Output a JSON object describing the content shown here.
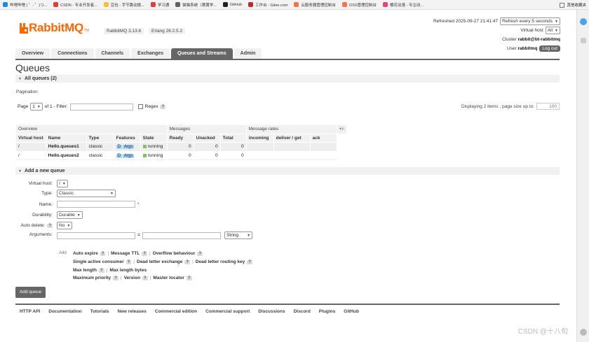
{
  "bookmarks": [
    {
      "label": "哔哩哔哩 ( ゜- ゜)つ...",
      "color": "#1e88e5"
    },
    {
      "label": "CSDN - 专业开发者...",
      "color": "#e53935"
    },
    {
      "label": "豆包 - 字节跳动旗...",
      "color": "#fbc02d"
    },
    {
      "label": "学习通",
      "color": "#e53935"
    },
    {
      "label": "猫猫系统（莆莆学...",
      "color": "#616161"
    },
    {
      "label": "GitHub",
      "color": "#212121"
    },
    {
      "label": "工作台 - Gitee.com",
      "color": "#c62828"
    },
    {
      "label": "云服务器管理控制台",
      "color": "#ff7043"
    },
    {
      "label": "OSS管理控制台",
      "color": "#ff7043"
    },
    {
      "label": "樱花动漫 - 专注动...",
      "color": "#ec407a"
    }
  ],
  "bookmarks_folder": "其他收藏夹",
  "brand": "RabbitMQ",
  "brand_tm": "TM",
  "version_rabbit": "RabbitMQ 3.13.6",
  "version_erlang": "Erlang 26.2.5.2",
  "status": {
    "refreshed_label": "Refreshed",
    "refreshed_time": "2025-09-27 21:41:47",
    "refresh_option": "Refresh every 5 seconds",
    "vhost_label": "Virtual host",
    "vhost_value": "All",
    "cluster_label": "Cluster",
    "cluster_value": "rabbit@bt-rabbitmq",
    "user_label": "User",
    "user_value": "rabbitmq",
    "logout": "Log out"
  },
  "nav": {
    "overview": "Overview",
    "connections": "Connections",
    "channels": "Channels",
    "exchanges": "Exchanges",
    "queues": "Queues and Streams",
    "admin": "Admin"
  },
  "page_title": "Queues",
  "all_queues": "All queues (2)",
  "pagination": {
    "label": "Pagination",
    "page_label": "Page",
    "page_value": "1",
    "of_label": "of 1",
    "filter_label": "- Filter:",
    "regex_label": "Regex",
    "help": "?",
    "display_text": "Displaying 2 items , page size up to:",
    "page_size": "100"
  },
  "table": {
    "groups": {
      "overview": "Overview",
      "messages": "Messages",
      "rates": "Message rates",
      "plusminus": "+/-"
    },
    "columns": [
      "Virtual host",
      "Name",
      "Type",
      "Features",
      "State",
      "Ready",
      "Unacked",
      "Total",
      "incoming",
      "deliver / get",
      "ack"
    ],
    "rows": [
      {
        "vhost": "/",
        "name": "Hello.queues1",
        "type": "classic",
        "feat1": "D",
        "feat2": "Args",
        "state": "running",
        "ready": "0",
        "unacked": "0",
        "total": "0"
      },
      {
        "vhost": "/",
        "name": "Hello.queues2",
        "type": "classic",
        "feat1": "D",
        "feat2": "Args",
        "state": "running",
        "ready": "0",
        "unacked": "0",
        "total": "0"
      }
    ]
  },
  "add_queue": {
    "header": "Add a new queue",
    "vhost_label": "Virtual host:",
    "vhost_value": "/",
    "type_label": "Type:",
    "type_value": "Classic",
    "name_label": "Name:",
    "required": "*",
    "durability_label": "Durability:",
    "durability_value": "Durable",
    "autodelete_label": "Auto delete:",
    "autodelete_value": "No",
    "arguments_label": "Arguments:",
    "eq": "=",
    "arg_type": "String",
    "add_link": "Add",
    "hints_row1": [
      "Auto expire",
      "Message TTL",
      "Overflow behaviour"
    ],
    "hints_row2": [
      "Single active consumer",
      "Dead letter exchange",
      "Dead letter routing key"
    ],
    "hints_row3": [
      "Max length",
      "Max length bytes"
    ],
    "hints_row4": [
      "Maximum priority",
      "Version",
      "Master locator"
    ],
    "button": "Add queue"
  },
  "footer": [
    "HTTP API",
    "Documentation",
    "Tutorials",
    "New releases",
    "Commercial edition",
    "Commercial support",
    "Discussions",
    "Discord",
    "Plugins",
    "GitHub"
  ],
  "watermark": "CSDN @十八旬"
}
